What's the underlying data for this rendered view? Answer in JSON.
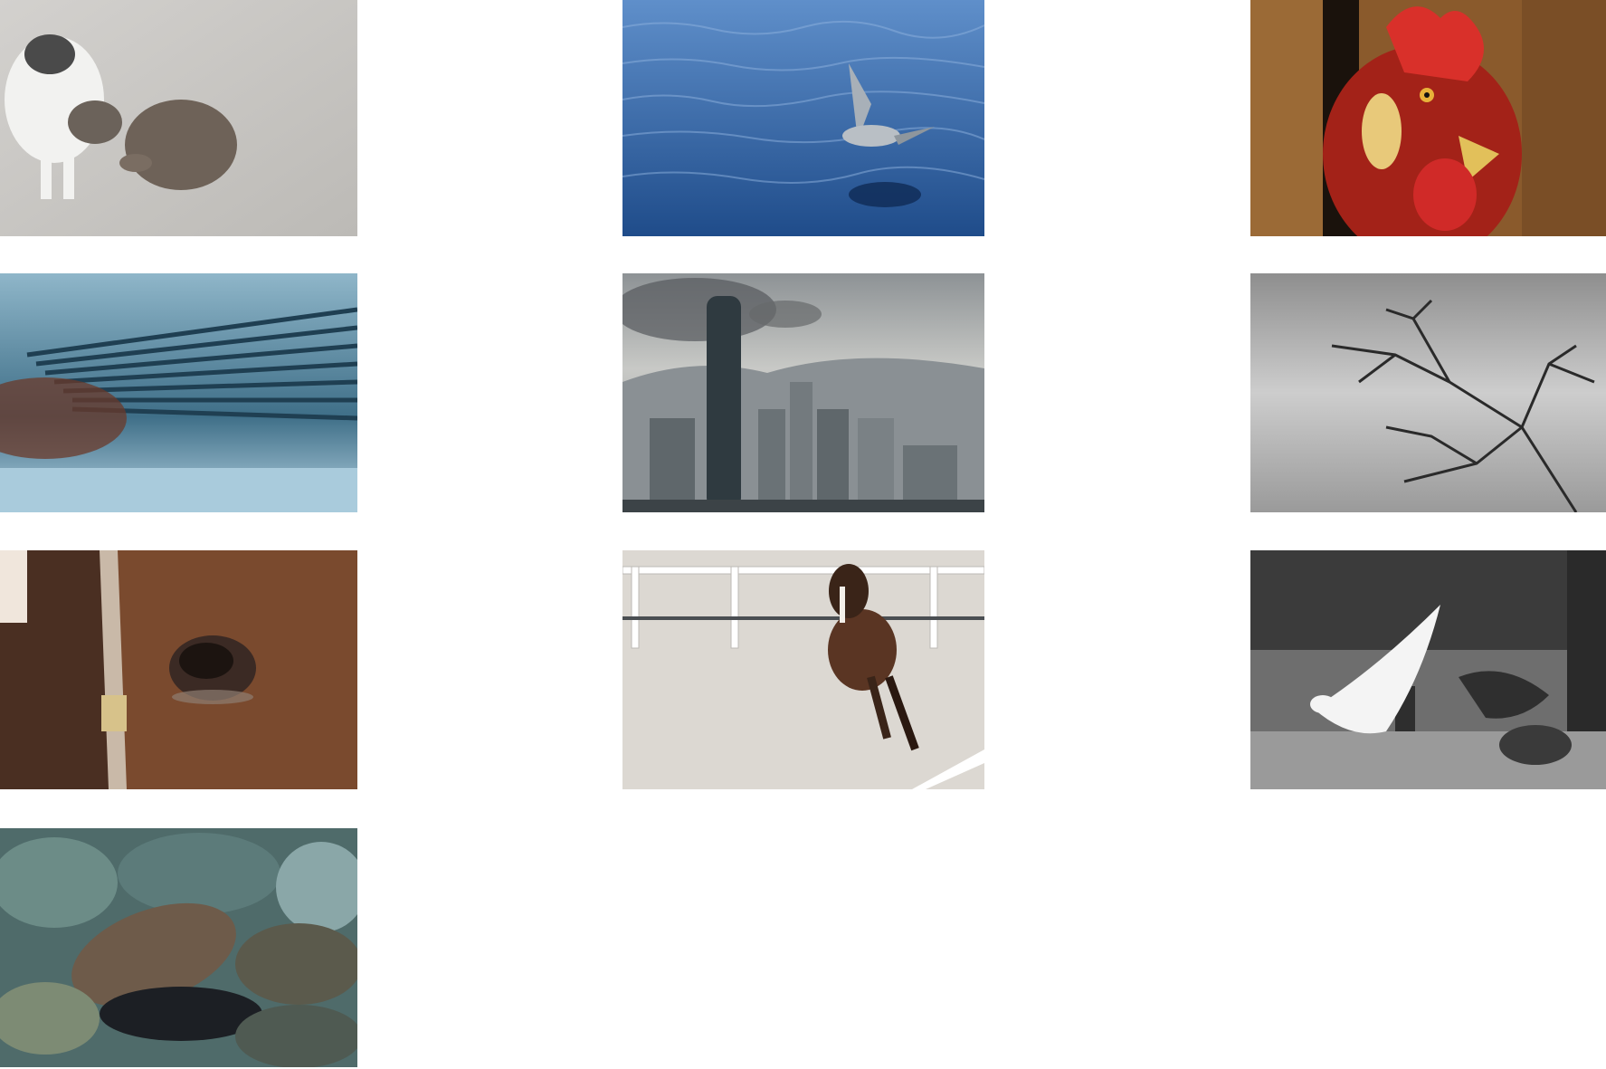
{
  "gallery": {
    "columns": 3,
    "thumbnails": [
      {
        "subject": "kittens",
        "palette": [
          "#c9c7c4",
          "#6e6258",
          "#f2f2f0"
        ]
      },
      {
        "subject": "seagull-over-water",
        "palette": [
          "#2f5d99",
          "#4f7fbd",
          "#9aa3ab"
        ]
      },
      {
        "subject": "rooster",
        "palette": [
          "#b0281f",
          "#8a5a2c",
          "#e8c97a"
        ]
      },
      {
        "subject": "fan-blades",
        "palette": [
          "#2e5a70",
          "#8fb6c9",
          "#6b3a2a"
        ]
      },
      {
        "subject": "city-skyline",
        "palette": [
          "#6d7377",
          "#a7a9a8",
          "#2f3a40"
        ]
      },
      {
        "subject": "bare-tree",
        "palette": [
          "#9a9a9a",
          "#cfcfcf",
          "#2a2a2a"
        ]
      },
      {
        "subject": "horse-eye",
        "palette": [
          "#7a4a2e",
          "#3b2a24",
          "#c9b9a8"
        ]
      },
      {
        "subject": "running-horse",
        "palette": [
          "#dcd8d2",
          "#5a3523",
          "#ffffff"
        ]
      },
      {
        "subject": "doves",
        "palette": [
          "#3b3b3b",
          "#f4f4f4",
          "#8a8a8a"
        ]
      },
      {
        "subject": "wet-pebbles",
        "palette": [
          "#5c7b7a",
          "#6e5b4a",
          "#1c1f24"
        ]
      }
    ]
  }
}
